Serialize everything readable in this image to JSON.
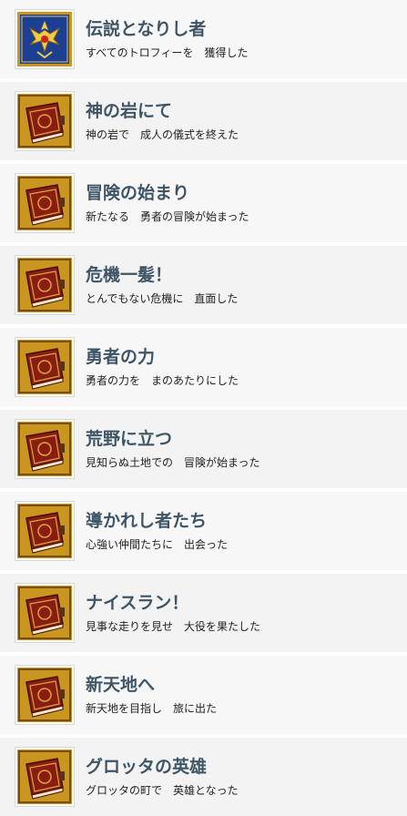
{
  "colors": {
    "title_text": "#3e5566",
    "desc_text": "#222222",
    "row_bg_odd": "#f7f7f7",
    "row_bg_even": "#f3f3f3",
    "gold": "#c9961f",
    "book_red": "#8a1d12",
    "crest_blue": "#1d3f91"
  },
  "trophies": [
    {
      "icon": "dragon-quest-crest-icon",
      "title": "伝説となりし者",
      "description": "すべてのトロフィーを　獲得した"
    },
    {
      "icon": "red-book-icon",
      "title": "神の岩にて",
      "description": "神の岩で　成人の儀式を終えた"
    },
    {
      "icon": "red-book-icon",
      "title": "冒険の始まり",
      "description": "新たなる　勇者の冒険が始まった"
    },
    {
      "icon": "red-book-icon",
      "title": "危機一髪！",
      "description": "とんでもない危機に　直面した"
    },
    {
      "icon": "red-book-icon",
      "title": "勇者の力",
      "description": "勇者の力を　まのあたりにした"
    },
    {
      "icon": "red-book-icon",
      "title": "荒野に立つ",
      "description": "見知らぬ土地での　冒険が始まった"
    },
    {
      "icon": "red-book-icon",
      "title": "導かれし者たち",
      "description": "心強い仲間たちに　出会った"
    },
    {
      "icon": "red-book-icon",
      "title": "ナイスラン！",
      "description": "見事な走りを見せ　大役を果たした"
    },
    {
      "icon": "red-book-icon",
      "title": "新天地へ",
      "description": "新天地を目指し　旅に出た"
    },
    {
      "icon": "red-book-icon",
      "title": "グロッタの英雄",
      "description": "グロッタの町で　英雄となった"
    }
  ]
}
